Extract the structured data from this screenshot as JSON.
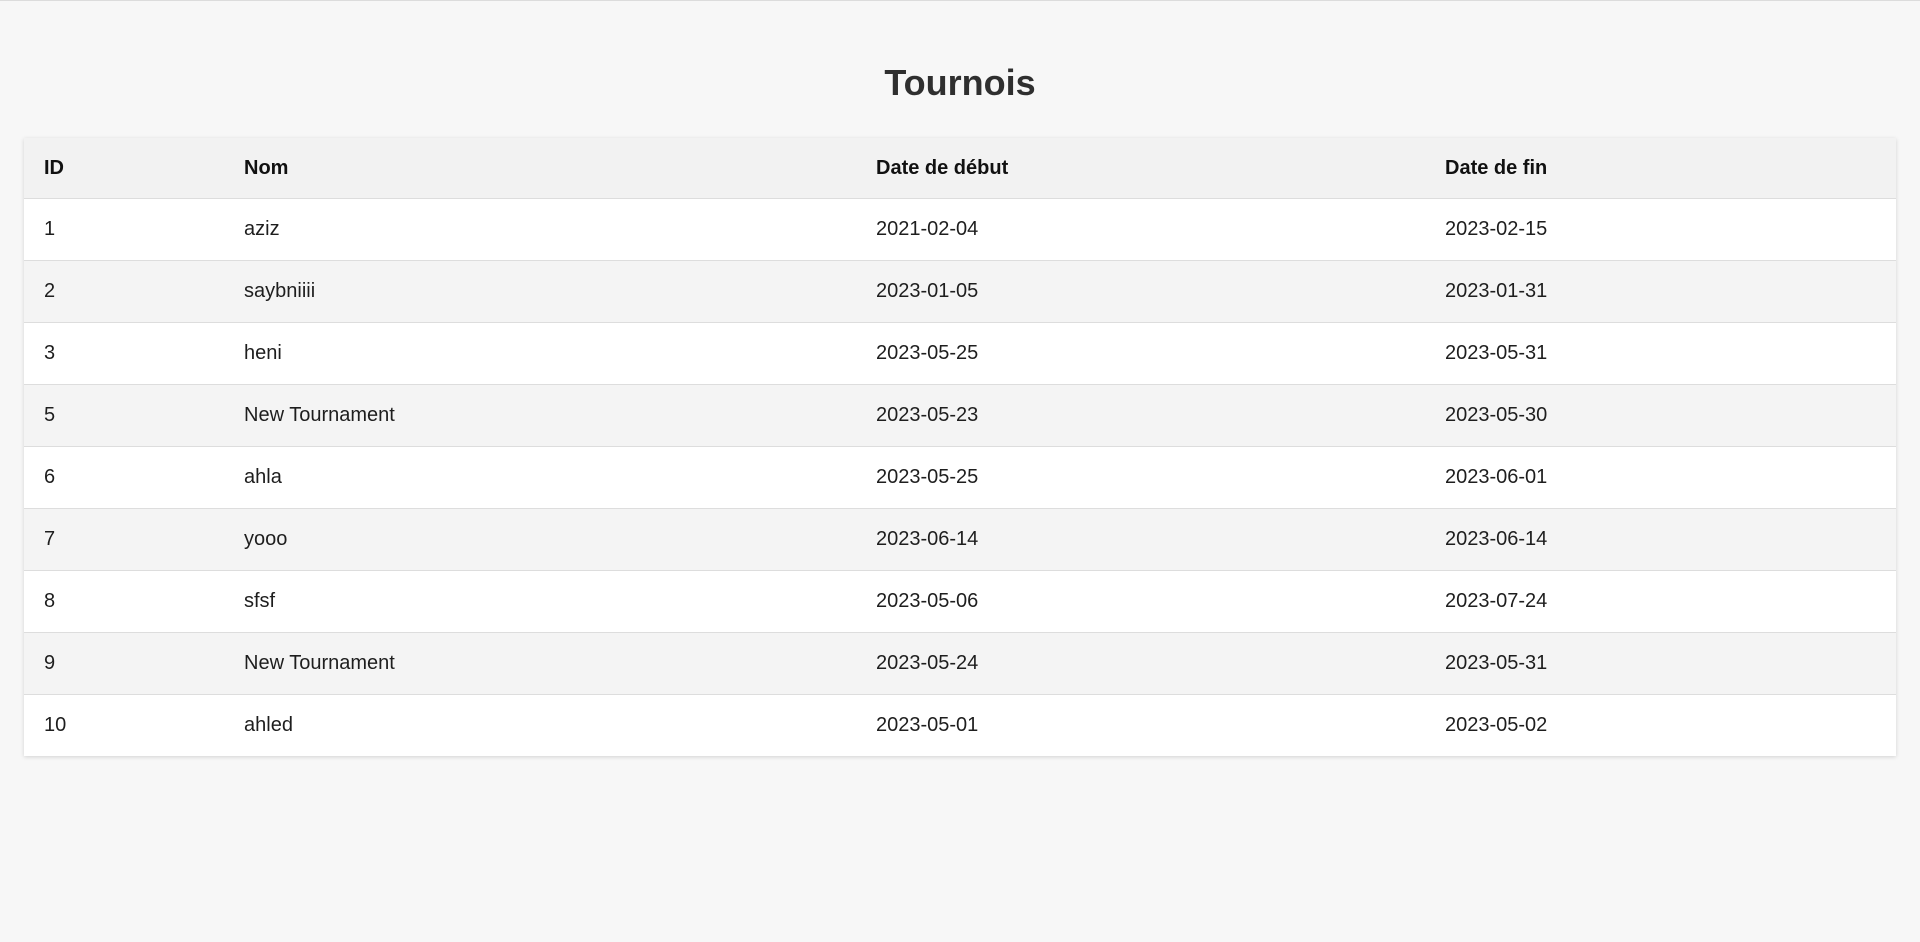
{
  "page": {
    "title": "Tournois"
  },
  "table": {
    "headers": {
      "id": "ID",
      "name": "Nom",
      "start": "Date de début",
      "end": "Date de fin"
    },
    "rows": [
      {
        "id": "1",
        "name": "aziz",
        "start": "2021-02-04",
        "end": "2023-02-15"
      },
      {
        "id": "2",
        "name": "saybniiii",
        "start": "2023-01-05",
        "end": "2023-01-31"
      },
      {
        "id": "3",
        "name": "heni",
        "start": "2023-05-25",
        "end": "2023-05-31"
      },
      {
        "id": "5",
        "name": "New Tournament",
        "start": "2023-05-23",
        "end": "2023-05-30"
      },
      {
        "id": "6",
        "name": "ahla",
        "start": "2023-05-25",
        "end": "2023-06-01"
      },
      {
        "id": "7",
        "name": "yooo",
        "start": "2023-06-14",
        "end": "2023-06-14"
      },
      {
        "id": "8",
        "name": "sfsf",
        "start": "2023-05-06",
        "end": "2023-07-24"
      },
      {
        "id": "9",
        "name": "New Tournament",
        "start": "2023-05-24",
        "end": "2023-05-31"
      },
      {
        "id": "10",
        "name": "ahled",
        "start": "2023-05-01",
        "end": "2023-05-02"
      }
    ]
  }
}
